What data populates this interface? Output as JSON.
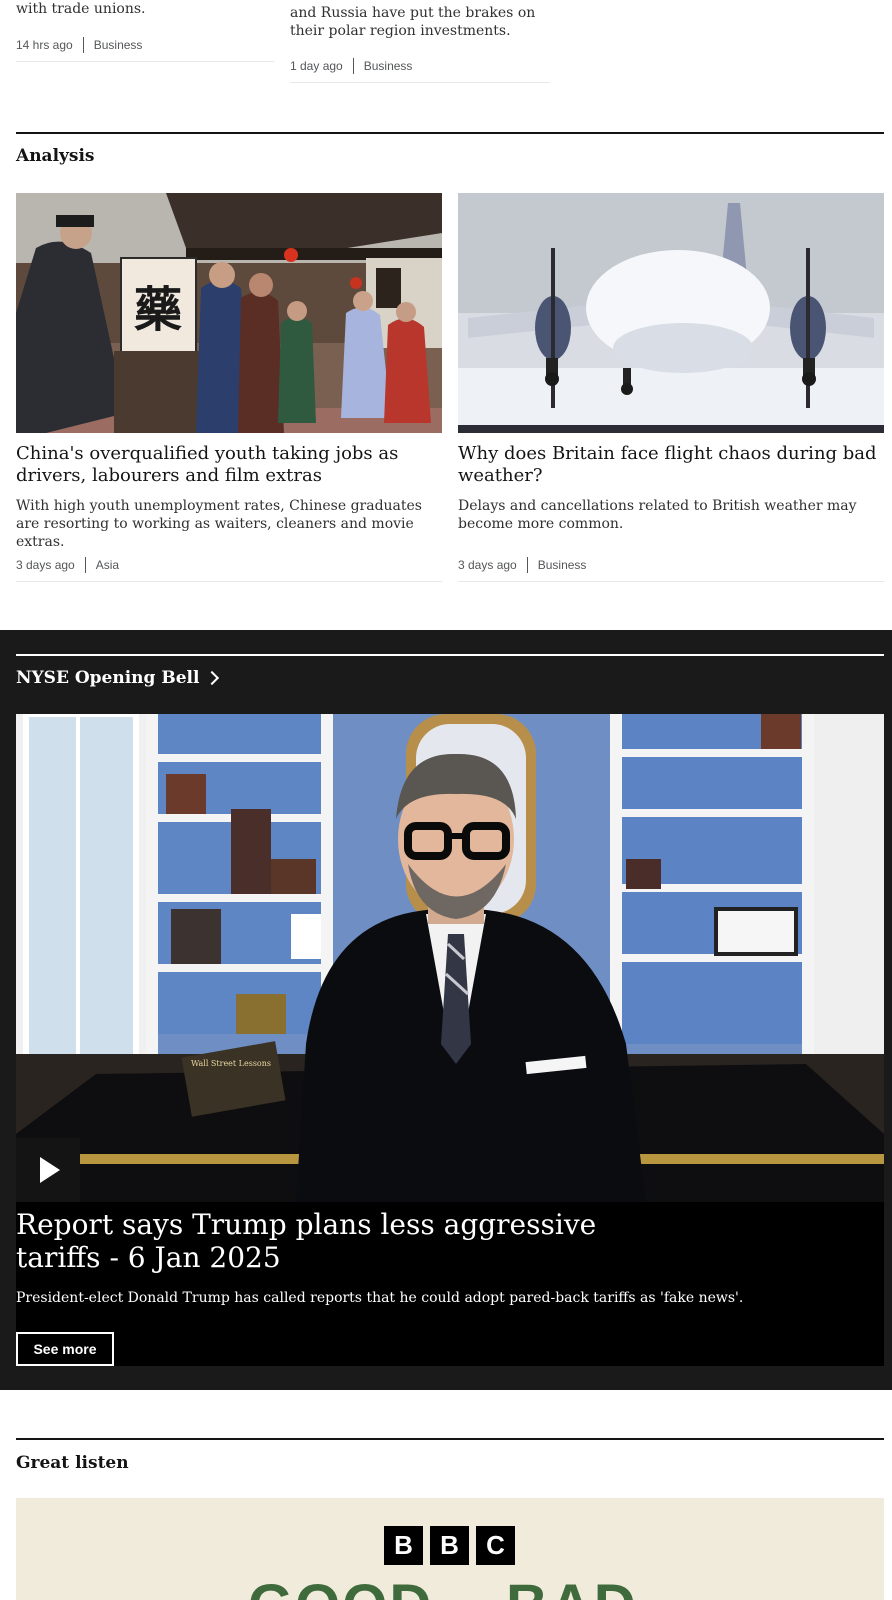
{
  "top_cards": [
    {
      "summary": "with trade unions.",
      "time": "14 hrs ago",
      "category": "Business"
    },
    {
      "summary_lines": [
        "and Russia have put the brakes on",
        "their polar region investments."
      ],
      "time": "1 day ago",
      "category": "Business"
    }
  ],
  "analysis": {
    "title": "Analysis",
    "cards": [
      {
        "headline": "China's overqualified youth taking jobs as drivers, labourers and film extras",
        "summary": "With high youth unemployment rates, Chinese graduates are resorting to working as waiters, cleaners and movie extras.",
        "time": "3 days ago",
        "category": "Asia",
        "sign_char": "藥"
      },
      {
        "headline": "Why does Britain face flight chaos during bad weather?",
        "summary": "Delays and cancellations related to British weather may become more common.",
        "time": "3 days ago",
        "category": "Business"
      }
    ]
  },
  "nyse": {
    "title": "NYSE Opening Bell",
    "video": {
      "title": "Report says Trump plans less aggressive tariffs - 6 Jan 2025",
      "summary": "President-elect Donald Trump has called reports that he could adopt pared-back tariffs as 'fake news'.",
      "book_title": "Wall Street Lessons"
    },
    "see_more": "See more"
  },
  "great_listen": {
    "title": "Great listen",
    "logo": [
      "B",
      "B",
      "C"
    ],
    "show_word_left": "GOOD",
    "show_word_right": "BAD"
  },
  "colors": {
    "dark_section": "#1a1a1a",
    "listen_bg": "#f1ebdb",
    "podcast_green": "#3f6b3c"
  }
}
